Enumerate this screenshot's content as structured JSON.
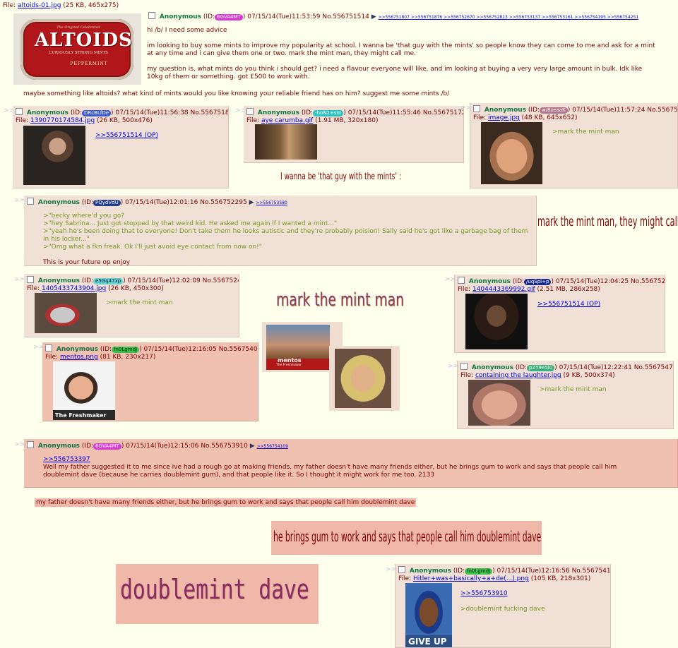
{
  "op": {
    "file_label": "File:",
    "file_name": "altoids-01.jpg",
    "file_meta": "(25 KB, 465x275)",
    "name": "Anonymous",
    "id_prefix": "(ID:",
    "id": "6GVA4MT",
    "id_suffix": ")",
    "datetime": "07/15/14(Tue)11:53:59",
    "number": "No.556751514",
    "reply_arrow": "▶",
    "backlinks": ">>556751807 >>556751876 >>556752670 >>556752813 >>556753137 >>556753161 >>556754195 >>556754251",
    "image_text": {
      "top": "The Original Celebrated",
      "brand": "ALTOIDS",
      "sub": "CURIOUSLY STRONG MINTS",
      "flavor": "PEPPERMINT"
    },
    "p1": "hi /b/ I need some advice",
    "p2": "im looking to buy some mints to improve my popularity at school. I wanna be 'that guy with the mints' so people know they can come to me and ask for a mint at any time and i can give them one or two. mark the mint man, they might call me.",
    "p3": "my question is, what mints do you think i should get? i need a flavour everyone will like, and im looking at buying a very very large amount in bulk. Idk like 10kg of them or something. got £500 to work with.",
    "p4": "maybe something like altoids? what kind of mints would you like knowing your reliable friend has on him? suggest me some mints /b/"
  },
  "arrows": ">>",
  "posts": {
    "p1807": {
      "name": "Anonymous",
      "id": "DRcBLfDe",
      "datetime": "07/15/14(Tue)11:56:38",
      "number": "No.556751807",
      "file_name": "1390770174584.jpg",
      "file_meta": "(26 KB, 500x476)",
      "quote": ">>556751514 (OP)",
      "arrow": "▶"
    },
    "p1724": {
      "name": "Anonymous",
      "id": "-hoN2+sm",
      "datetime": "07/15/14(Tue)11:55:46",
      "number": "No.556751724",
      "file_name": "aye carumba.gif",
      "file_meta": "(1.91 MB, 320x180)",
      "arrow": "▶"
    },
    "p1889": {
      "name": "Anonymous",
      "id": "w/8zeaaK",
      "datetime": "07/15/14(Tue)11:57:24",
      "number": "No.556751889",
      "file_name": "image.jpg",
      "file_meta": "(48 KB, 645x652)",
      "greentext": ">mark the mint man"
    },
    "p2295": {
      "name": "Anonymous",
      "id": "PQydVdU",
      "datetime": "07/15/14(Tue)12:01:16",
      "number": "No.556752295",
      "arrow": "▶",
      "backlink": ">>556753580",
      "lines": [
        ">\"becky where'd you go?",
        ">\"hey Sabrina... Just got stopped by that weird kid. He asked me again if I wanted a mint...\"",
        ">\"yeah he's been doing that to everyone! Don't take them he looks autistic and they're probably poision! Sally said he's got like a garbage bag of them in his locker...\"",
        ">\"Omg what a fkn freak. Ok I'll just avoid eye contact from now on!\""
      ],
      "closing": "This is your future op enjoy"
    },
    "p2405": {
      "name": "Anonymous",
      "id": "e5Gq47xp",
      "datetime": "07/15/14(Tue)12:02:09",
      "number": "No.556752405",
      "arrow": "▶",
      "file_name": "1405433743904.jpg",
      "file_meta": "(26 KB, 450x300)",
      "greentext": ">mark the mint man"
    },
    "p2670": {
      "name": "Anonymous",
      "id": "/uqSpl+p",
      "datetime": "07/15/14(Tue)12:04:25",
      "number": "No.556752670",
      "arrow": "▶",
      "file_name": "1404443369992.gif",
      "file_meta": "(2.51 MB, 286x258)",
      "quote": ">>556751514 (OP)"
    },
    "p4014": {
      "name": "Anonymous",
      "id": "fn0LgmdJ",
      "datetime": "07/15/14(Tue)12:16:05",
      "number": "No.556754014",
      "arrow": "▶",
      "file_name": "mentos.png",
      "file_meta": "(81 KB, 230x217)",
      "caption": "The Freshmaker"
    },
    "p4775": {
      "name": "Anonymous",
      "id": "pZY9e5l0",
      "datetime": "07/15/14(Tue)12:22:41",
      "number": "No.556754775",
      "arrow": "▶",
      "file_name": "containing the laughter.jpg",
      "file_meta": "(9 KB, 500x374)",
      "greentext": ">mark the mint man"
    },
    "p3910": {
      "name": "Anonymous",
      "id": "6GVA4MT",
      "datetime": "07/15/14(Tue)12:15:06",
      "number": "No.556753910",
      "arrow": "▶",
      "backlink": ">>556754109",
      "quote": ">>556753397",
      "body": "Well my father suggested it to me since ive had a rough go at making friends. my father doesn't have many friends either, but he brings gum to work and says that people call him doublemint dave (because he carries doublemint gum), and that people like it. So I thought it might work for me too. 2133"
    },
    "p4109": {
      "name": "Anonymous",
      "id": "fn0LgmdJ",
      "datetime": "07/15/14(Tue)12:16:56",
      "number": "No.556754109",
      "arrow": "▶",
      "file_name": "Hitler+was+basically+a+de(...).png",
      "file_meta": "(105 KB, 218x301)",
      "quote": ">>556753910",
      "greentext": ">doublemint fucking dave",
      "caption": "GIVE UP"
    }
  },
  "overlays": {
    "that_guy": "I wanna be 'that guy with the mints' :",
    "mint_man_call": "mark the mint man, they might call me.",
    "mark_mint_man": "mark the mint man",
    "mentos_small": "mentos",
    "mentos_small_sub": "The Freshmaker",
    "father_line": "my father doesn't have many friends either, but he brings gum to work and says that people call him doublemint dave",
    "brings_gum": "he brings gum to work and says that people call him doublemint dave",
    "doublemint": "doublemint dave"
  },
  "colors": {
    "bg": "#ffffee",
    "post_bg": "#f0e0d6",
    "highlight": "#f0c0b0",
    "name": "#117743",
    "text": "#800000",
    "greentext": "#789922",
    "link": "#0000ee"
  }
}
